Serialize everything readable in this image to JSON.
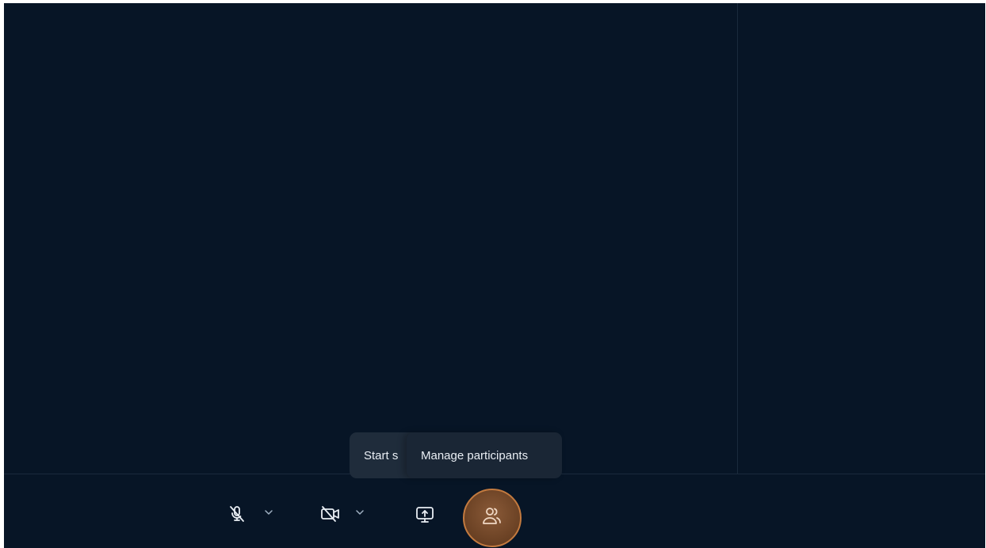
{
  "tooltips": {
    "share_partial": "Start s",
    "manage_participants": "Manage participants"
  },
  "toolbar": {
    "mic": {
      "icon": "mic-muted-icon",
      "state": "muted"
    },
    "camera": {
      "icon": "camera-off-icon",
      "state": "off"
    },
    "share": {
      "icon": "share-screen-icon"
    },
    "participants": {
      "icon": "participants-icon",
      "active": true
    }
  },
  "colors": {
    "background": "#071526",
    "tooltip": "#1a2635",
    "accent": "#c37a3f",
    "active_button": "#6e4426"
  }
}
